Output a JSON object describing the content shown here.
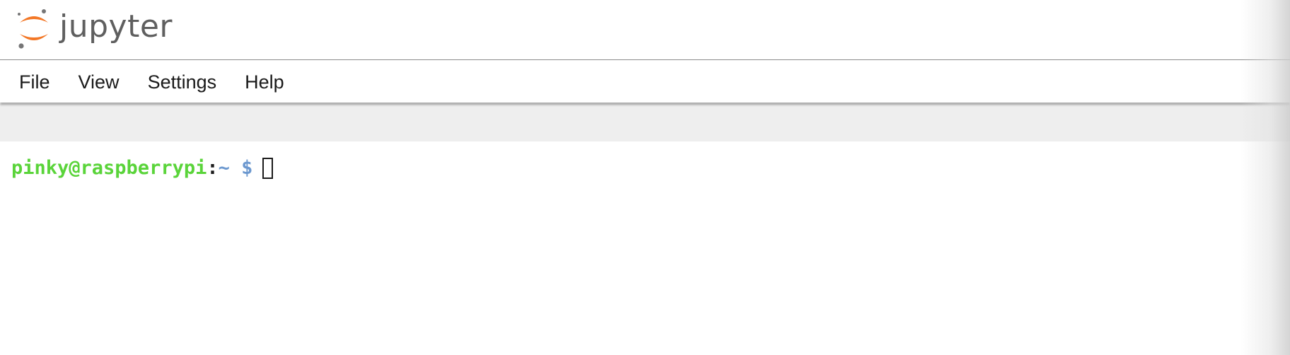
{
  "app": {
    "logo_text": "jupyter",
    "logo_icon": "jupyter-logo-icon",
    "colors": {
      "logo_orange": "#f37726",
      "logo_gray": "#767677"
    }
  },
  "menubar": {
    "items": [
      {
        "label": "File"
      },
      {
        "label": "View"
      },
      {
        "label": "Settings"
      },
      {
        "label": "Help"
      }
    ]
  },
  "terminal": {
    "user_host": "pinky@raspberrypi",
    "colon": ":",
    "path": "~",
    "dollar": "$",
    "colors": {
      "user_host": "#5ad43a",
      "path": "#6c98cf",
      "text": "#1b1b1b"
    }
  }
}
